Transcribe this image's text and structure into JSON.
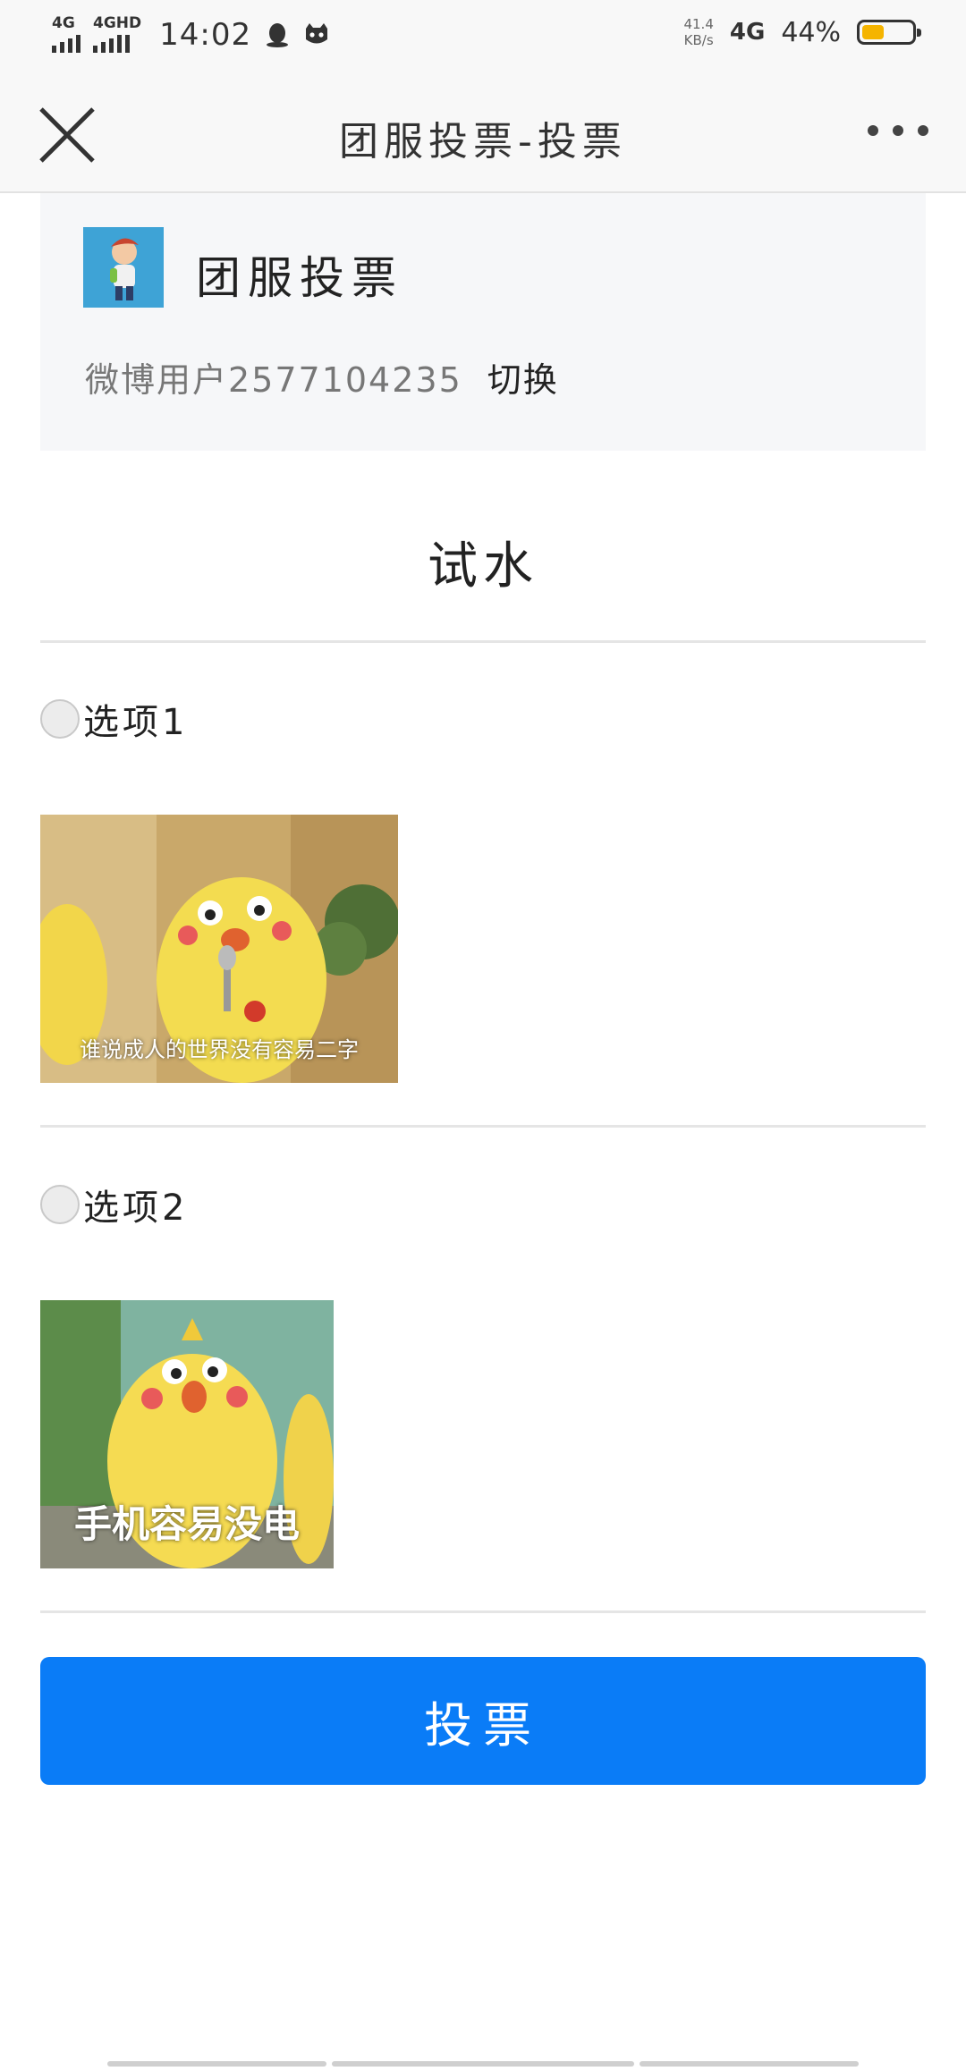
{
  "status_bar": {
    "net1": "4G",
    "net2": "4GHD",
    "time": "14:02",
    "speed_value": "41.4",
    "speed_unit": "KB/s",
    "network": "4G",
    "battery_percent": "44%",
    "battery_level": 0.44,
    "battery_color": "#f5b400"
  },
  "titlebar": {
    "title": "团服投票-投票"
  },
  "header": {
    "app_name": "团服投票",
    "username": "微博用户2577104235",
    "switch_label": "切换"
  },
  "poll": {
    "title": "试水",
    "options": [
      {
        "label": "选项1",
        "caption": "谁说成人的世界没有容易二字"
      },
      {
        "label": "选项2",
        "caption": "手机容易没电"
      }
    ]
  },
  "vote_button": {
    "label": "投票",
    "color": "#0a7cf7"
  }
}
